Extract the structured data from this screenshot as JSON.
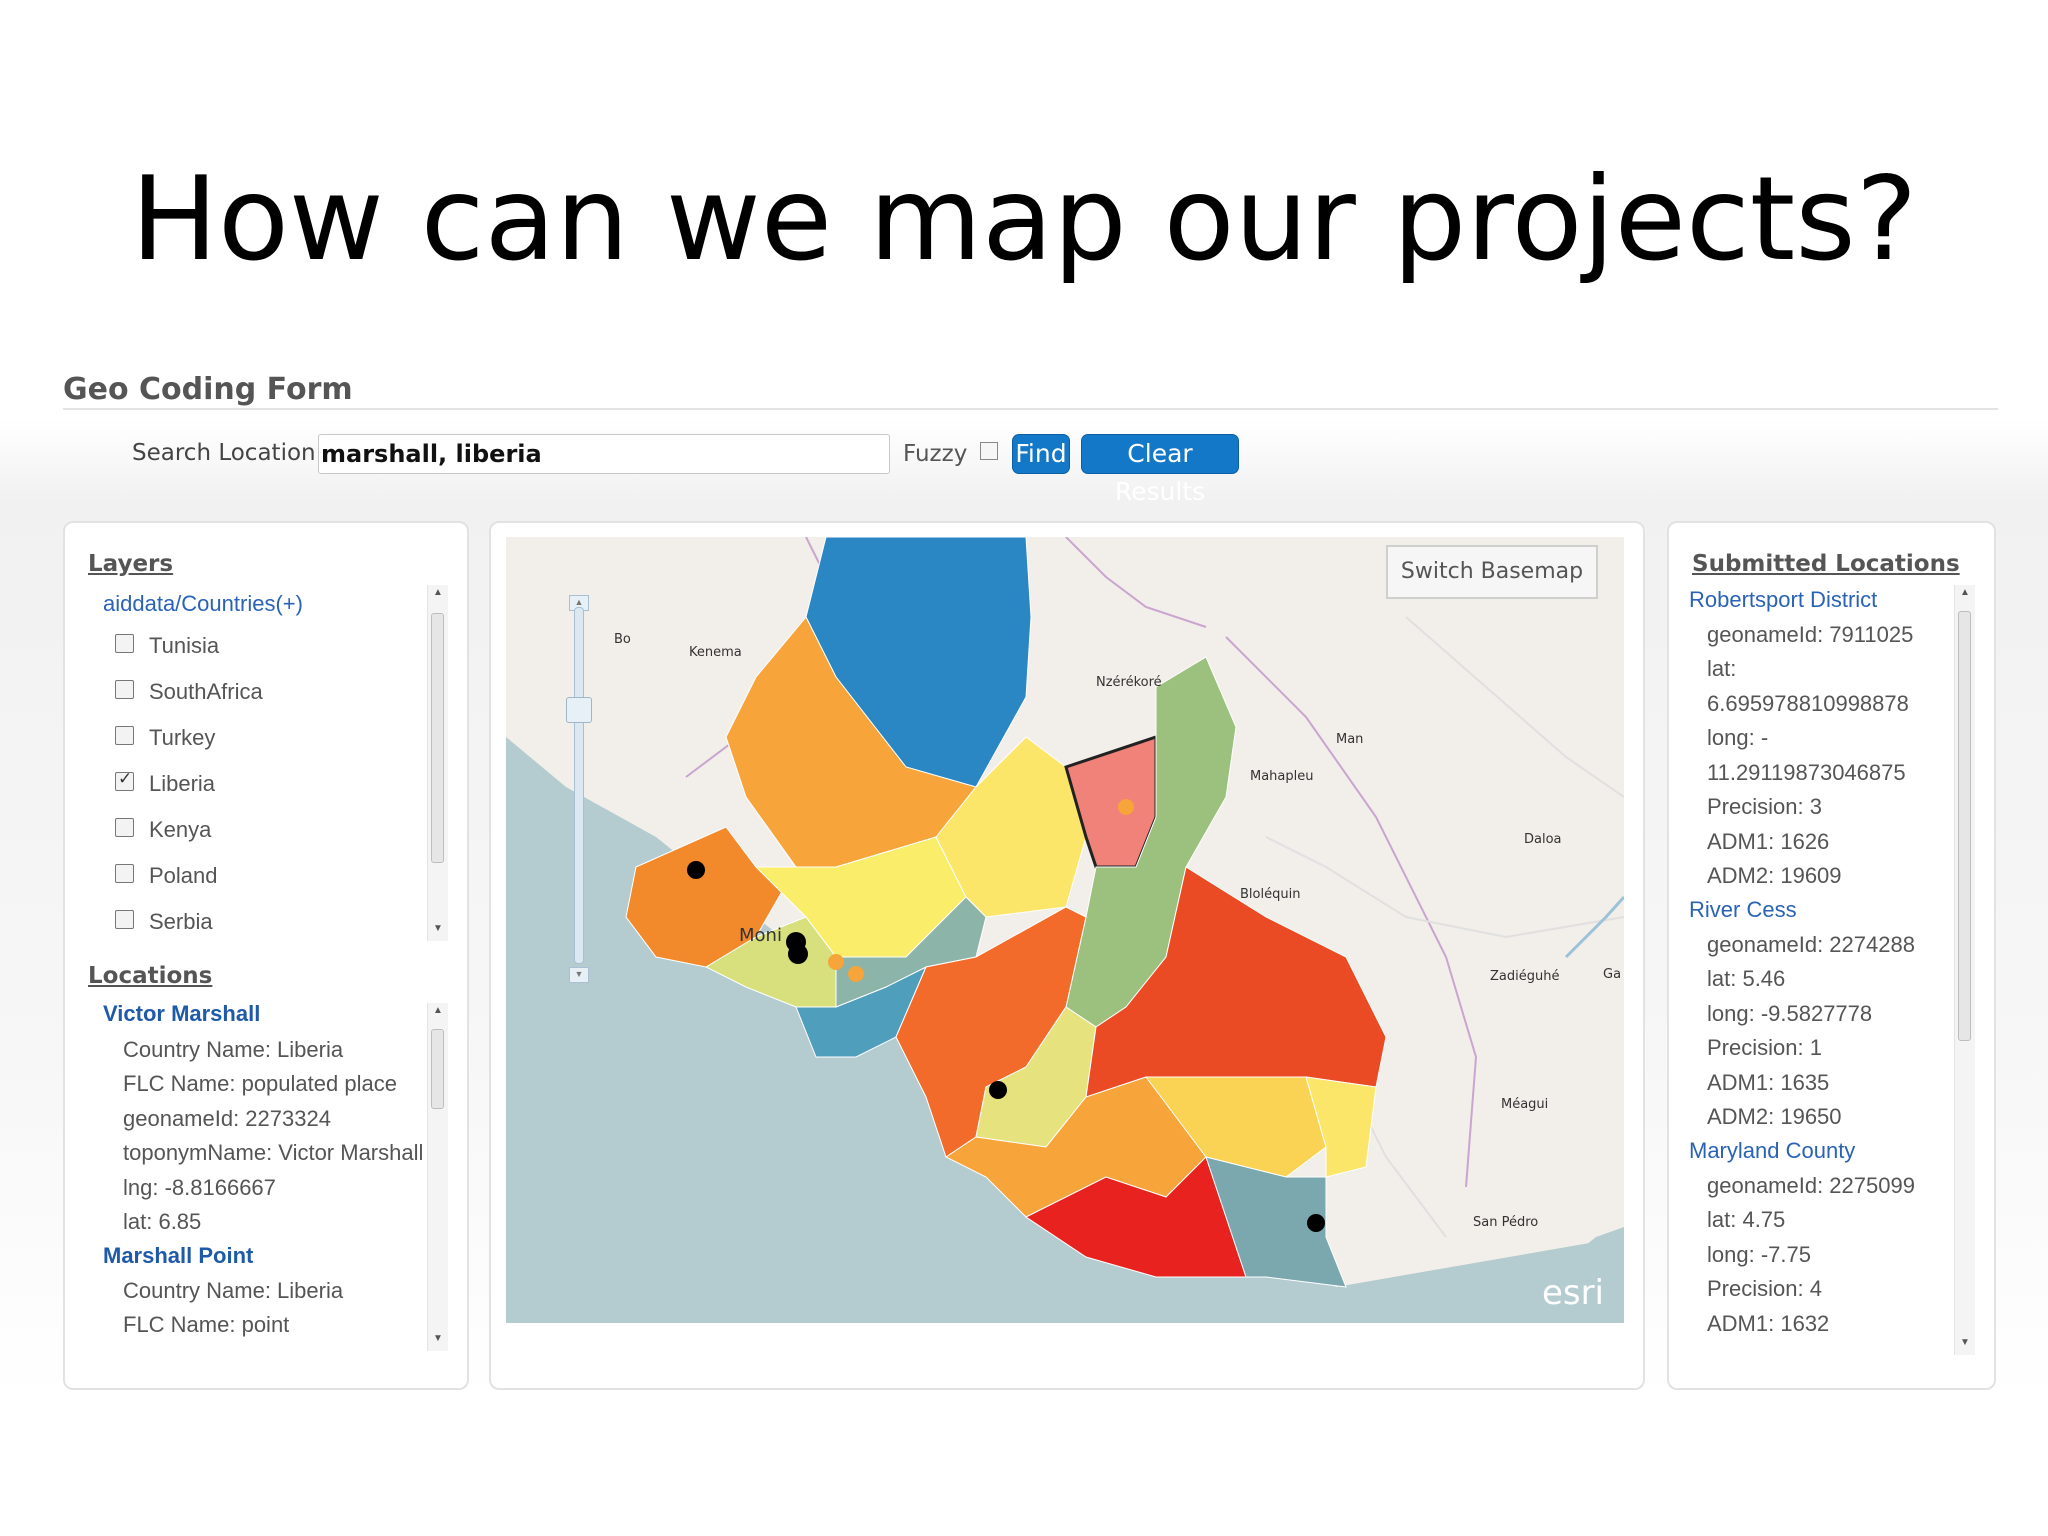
{
  "slide": {
    "title": "How can we map our projects?"
  },
  "form": {
    "title": "Geo Coding Form",
    "search_label": "Search Location",
    "search_value": "marshall, liberia",
    "fuzzy_label": "Fuzzy",
    "fuzzy_checked": false,
    "find_label": "Find",
    "clear_label": "Clear Results"
  },
  "layers": {
    "title": "Layers",
    "group": "aiddata/Countries(+)",
    "items": [
      {
        "label": "Tunisia",
        "checked": false
      },
      {
        "label": "SouthAfrica",
        "checked": false
      },
      {
        "label": "Turkey",
        "checked": false
      },
      {
        "label": "Liberia",
        "checked": true
      },
      {
        "label": "Kenya",
        "checked": false
      },
      {
        "label": "Poland",
        "checked": false
      },
      {
        "label": "Serbia",
        "checked": false
      }
    ]
  },
  "locations": {
    "title": "Locations",
    "results": [
      {
        "name": "Victor Marshall",
        "fields": [
          "Country Name: Liberia",
          "FLC Name: populated place",
          "geonameId: 2273324",
          "toponymName: Victor Marshall",
          "lng: -8.8166667",
          "lat: 6.85"
        ]
      },
      {
        "name": "Marshall Point",
        "fields": [
          "Country Name: Liberia",
          "FLC Name: point"
        ]
      }
    ]
  },
  "map": {
    "switch_basemap": "Switch Basemap",
    "attribution": "esri",
    "place_labels": [
      "Bo",
      "Kenema",
      "Nzérékoré",
      "Man",
      "Mahapleu",
      "Daloa",
      "Bloléquin",
      "Moni",
      "Zadiéguhé",
      "Ga",
      "Méagui",
      "San Pédro"
    ]
  },
  "submitted": {
    "title": "Submitted Locations",
    "items": [
      {
        "name": "Robertsport District",
        "fields": [
          "geonameId: 7911025",
          "lat:",
          "6.695978810998878",
          "long: -",
          "11.29119873046875",
          "Precision: 3",
          "ADM1: 1626",
          "ADM2: 19609"
        ]
      },
      {
        "name": "River Cess",
        "fields": [
          "geonameId: 2274288",
          "lat: 5.46",
          "long: -9.5827778",
          "Precision: 1",
          "ADM1: 1635",
          "ADM2: 19650"
        ]
      },
      {
        "name": "Maryland County",
        "fields": [
          "geonameId: 2275099",
          "lat: 4.75",
          "long: -7.75",
          "Precision: 4",
          "ADM1: 1632"
        ]
      }
    ]
  },
  "colors": {
    "button": "#1478c8",
    "link": "#2a63b5",
    "ocean": "#b4ccd0",
    "land": "#f2eee9"
  }
}
